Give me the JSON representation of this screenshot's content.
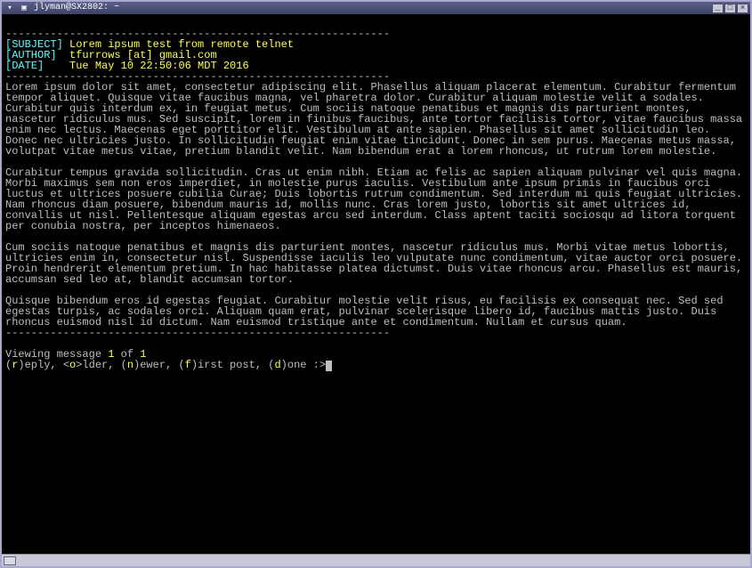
{
  "window": {
    "title": "jlyman@SX2802: ~"
  },
  "divider": "------------------------------------------------------------",
  "headers": {
    "subject_label": "[SUBJECT]",
    "subject_value": "Lorem ipsum test from remote telnet",
    "author_label": "[AUTHOR]",
    "author_value": "tfurrows [at] gmail.com",
    "date_label": "[DATE]",
    "date_value": "Tue May 10 22:50:06 MDT 2016"
  },
  "body": {
    "p1": "Lorem ipsum dolor sit amet, consectetur adipiscing elit. Phasellus aliquam placerat elementum. Curabitur fermentum tempor aliquet. Quisque vitae faucibus magna, vel pharetra dolor. Curabitur aliquam molestie velit a sodales. Curabitur quis interdum ex, in feugiat metus. Cum sociis natoque penatibus et magnis dis parturient montes, nascetur ridiculus mus. Sed suscipit, lorem in finibus faucibus, ante tortor facilisis tortor, vitae faucibus massa enim nec lectus. Maecenas eget porttitor elit. Vestibulum at ante sapien. Phasellus sit amet sollicitudin leo. Donec nec ultricies justo. In sollicitudin feugiat enim vitae tincidunt. Donec in sem purus. Maecenas metus massa, volutpat vitae metus vitae, pretium blandit velit. Nam bibendum erat a lorem rhoncus, ut rutrum lorem molestie.",
    "p2": "Curabitur tempus gravida sollicitudin. Cras ut enim nibh. Etiam ac felis ac sapien aliquam pulvinar vel quis magna. Morbi maximus sem non eros imperdiet, in molestie purus iaculis. Vestibulum ante ipsum primis in faucibus orci luctus et ultrices posuere cubilia Curae; Duis lobortis rutrum condimentum. Sed interdum mi quis feugiat ultricies. Nam rhoncus diam posuere, bibendum mauris id, mollis nunc. Cras lorem justo, lobortis sit amet ultrices id, convallis ut nisl. Pellentesque aliquam egestas arcu sed interdum. Class aptent taciti sociosqu ad litora torquent per conubia nostra, per inceptos himenaeos.",
    "p3": "Cum sociis natoque penatibus et magnis dis parturient montes, nascetur ridiculus mus. Morbi vitae metus lobortis, ultricies enim in, consectetur nisl. Suspendisse iaculis leo vulputate nunc condimentum, vitae auctor orci posuere. Proin hendrerit elementum pretium. In hac habitasse platea dictumst. Duis vitae rhoncus arcu. Phasellus est mauris, accumsan sed leo at, blandit accumsan tortor.",
    "p4": "Quisque bibendum eros id egestas feugiat. Curabitur molestie velit risus, eu facilisis ex consequat nec. Sed sed egestas turpis, ac sodales orci. Aliquam quam erat, pulvinar scelerisque libero id, faucibus mattis justo. Duis rhoncus euismod nisl id dictum. Nam euismod tristique ante et condimentum. Nullam et cursus quam."
  },
  "status": {
    "prefix": "Viewing message ",
    "current": "1",
    "mid": " of ",
    "total": "1"
  },
  "prompt": {
    "p1": "(",
    "k1": "r",
    "p2": ")eply, <",
    "k2": "o",
    "p3": ">lder, (",
    "k3": "n",
    "p4": ")ewer, (",
    "k4": "f",
    "p5": ")irst post, (",
    "k5": "d",
    "p6": ")one :>"
  }
}
